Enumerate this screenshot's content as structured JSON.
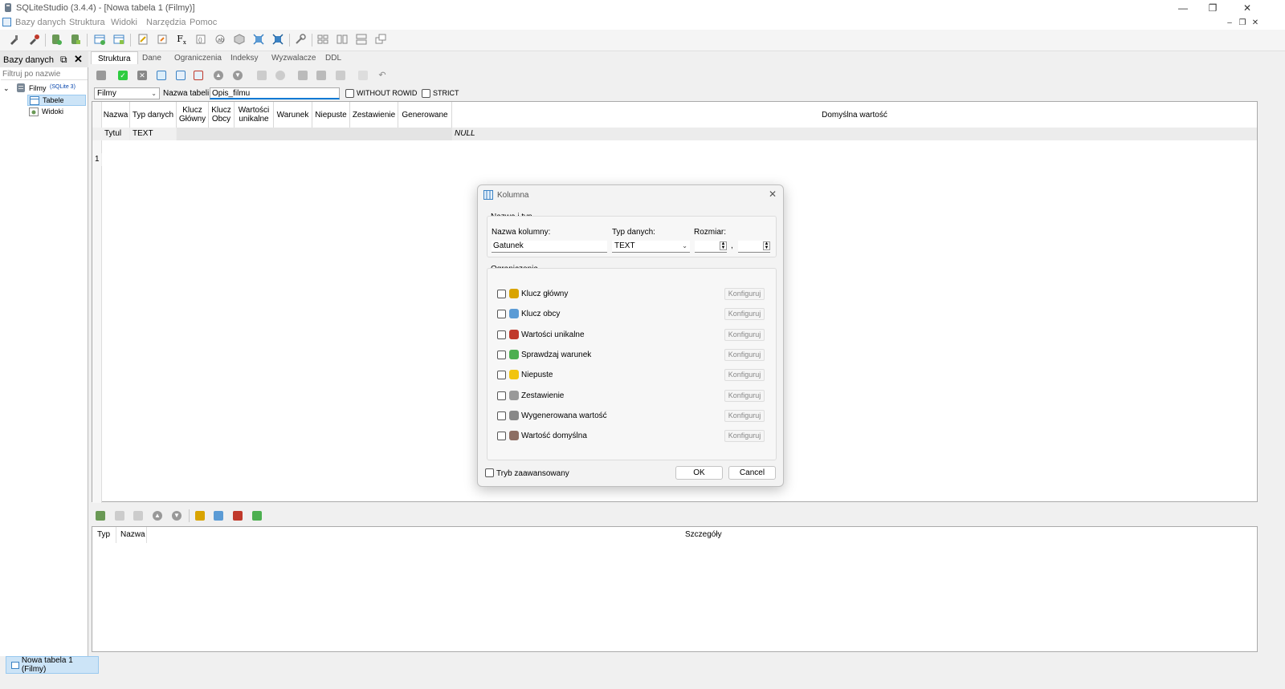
{
  "window": {
    "title": "SQLiteStudio (3.4.4) - [Nowa tabela 1 (Filmy)]",
    "minimize": "—",
    "maximize": "❐",
    "close": "✕"
  },
  "menu": [
    "Bazy danych",
    "Struktura",
    "Widoki",
    "Narzędzia",
    "Pomoc"
  ],
  "db_panel": {
    "title": "Bazy danych",
    "filter_placeholder": "Filtruj po nazwie",
    "db_name": "Filmy",
    "db_version": "(SQLite 3)",
    "tables": "Tabele",
    "views": "Widoki"
  },
  "tabs": [
    "Struktura",
    "Dane",
    "Ograniczenia",
    "Indeksy",
    "Wyzwalacze",
    "DDL"
  ],
  "table_editor": {
    "database": "Filmy",
    "table_name_label": "Nazwa tabeli:",
    "table_name": "Opis_filmu",
    "without_rowid": "WITHOUT ROWID",
    "strict": "STRICT"
  },
  "grid": {
    "headers": [
      "Nazwa",
      "Typ danych",
      "Klucz Główny",
      "Klucz Obcy",
      "Wartości unikalne",
      "Warunek",
      "Niepuste",
      "Zestawienie",
      "Generowane",
      "Domyślna wartość"
    ],
    "rows": [
      {
        "num": "1",
        "name": "Tytul",
        "type": "TEXT",
        "default": "NULL"
      }
    ]
  },
  "constraints_grid": {
    "headers": [
      "Typ",
      "Nazwa",
      "Szczegóły"
    ]
  },
  "taskbar": {
    "item": "Nowa tabela 1 (Filmy)"
  },
  "dialog": {
    "title": "Kolumna",
    "group_name_type": "Nazwa i typ",
    "column_name_label": "Nazwa kolumny:",
    "column_name": "Gatunek",
    "data_type_label": "Typ danych:",
    "data_type": "TEXT",
    "size_label": "Rozmiar:",
    "size_sep": ",",
    "group_constraints": "Ograniczenia",
    "constraints": [
      {
        "label": "Klucz główny",
        "icon": "key-icon",
        "color": "#d9a400"
      },
      {
        "label": "Klucz obcy",
        "icon": "foreign-key-icon",
        "color": "#5b9bd5"
      },
      {
        "label": "Wartości unikalne",
        "icon": "unique-icon",
        "color": "#c0392b"
      },
      {
        "label": "Sprawdzaj warunek",
        "icon": "check-condition-icon",
        "color": "#4caf50"
      },
      {
        "label": "Niepuste",
        "icon": "not-null-icon",
        "color": "#f1c40f"
      },
      {
        "label": "Zestawienie",
        "icon": "collation-icon",
        "color": "#999999"
      },
      {
        "label": "Wygenerowana wartość",
        "icon": "generated-icon",
        "color": "#888888"
      },
      {
        "label": "Wartość domyślna",
        "icon": "default-value-icon",
        "color": "#8d6e63"
      }
    ],
    "configure": "Konfiguruj",
    "advanced_mode": "Tryb zaawansowany",
    "ok": "OK",
    "cancel": "Cancel"
  },
  "colors": {
    "accent": "#0078d4",
    "selection": "#cce4f7"
  }
}
